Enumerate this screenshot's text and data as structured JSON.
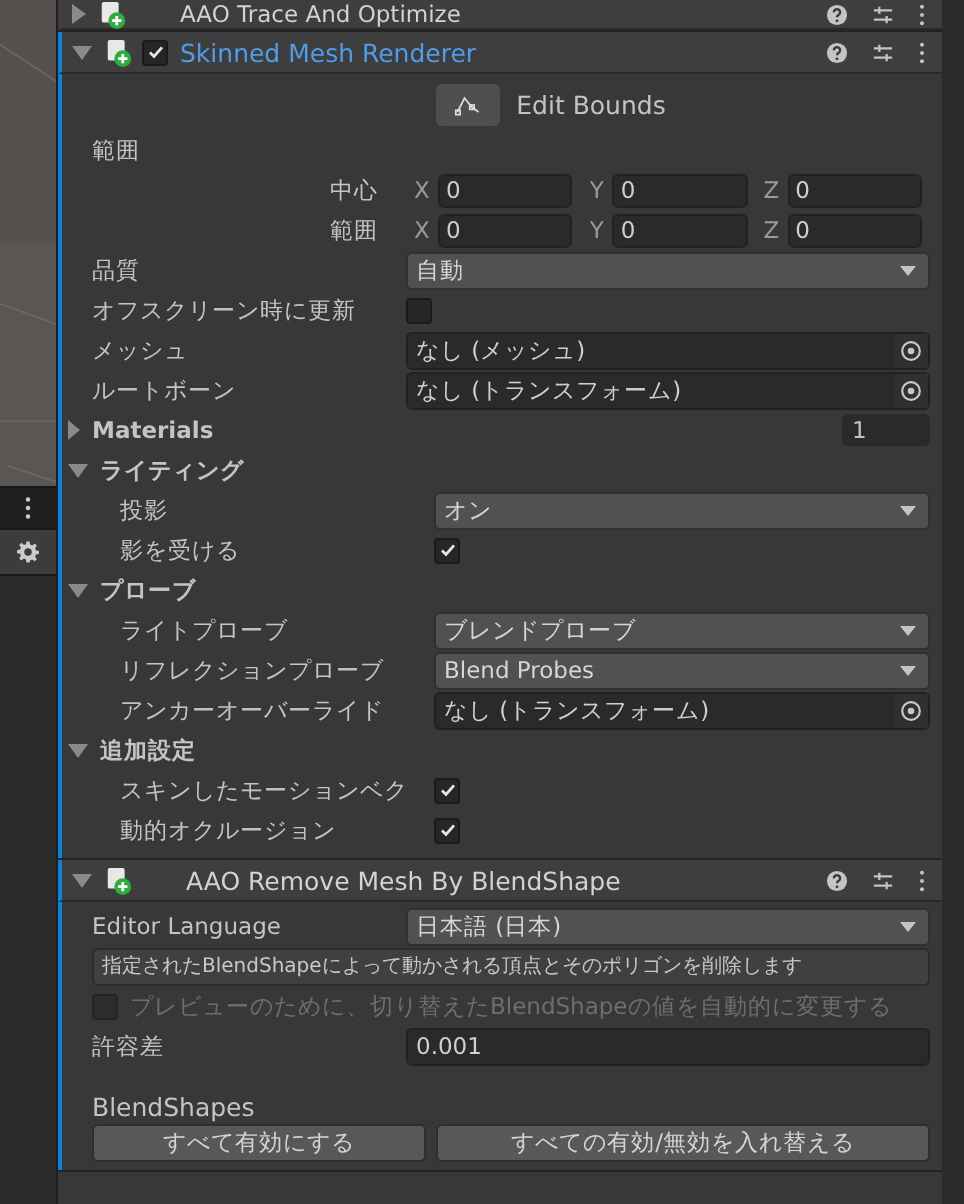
{
  "components": [
    {
      "title": "AAO Trace And Optimize",
      "expanded": false,
      "title_highlighted": false,
      "overridden": false
    },
    {
      "title": "Skinned Mesh Renderer",
      "expanded": true,
      "enabled": true,
      "title_highlighted": true,
      "overridden": true,
      "rows": [
        {
          "kind": "edit_bounds",
          "label": "Edit Bounds"
        },
        {
          "kind": "group",
          "label": "範囲",
          "children": [
            {
              "kind": "vector",
              "label": "中心",
              "fields": [
                {
                  "axis": "X",
                  "value": "0"
                },
                {
                  "axis": "Y",
                  "value": "0"
                },
                {
                  "axis": "Z",
                  "value": "0"
                }
              ]
            },
            {
              "kind": "vector",
              "label": "範囲",
              "fields": [
                {
                  "axis": "X",
                  "value": "0"
                },
                {
                  "axis": "Y",
                  "value": "0"
                },
                {
                  "axis": "Z",
                  "value": "0"
                }
              ]
            }
          ]
        },
        {
          "kind": "dropdown",
          "label": "品質",
          "value": "自動"
        },
        {
          "kind": "checkbox",
          "label": "オフスクリーン時に更新",
          "checked": false
        },
        {
          "kind": "object",
          "label": "メッシュ",
          "value": "なし (メッシュ)"
        },
        {
          "kind": "object",
          "label": "ルートボーン",
          "value": "なし (トランスフォーム)"
        },
        {
          "kind": "foldout",
          "label": "Materials",
          "expanded": false,
          "count": "1"
        },
        {
          "kind": "foldout",
          "label": "ライティング",
          "expanded": true,
          "children": [
            {
              "kind": "dropdown",
              "label": "投影",
              "value": "オン"
            },
            {
              "kind": "checkbox",
              "label": "影を受ける",
              "checked": true
            }
          ]
        },
        {
          "kind": "foldout",
          "label": "プローブ",
          "expanded": true,
          "children": [
            {
              "kind": "dropdown",
              "label": "ライトプローブ",
              "value": "ブレンドプローブ"
            },
            {
              "kind": "dropdown",
              "label": "リフレクションプローブ",
              "value": "Blend Probes"
            },
            {
              "kind": "object",
              "label": "アンカーオーバーライド",
              "value": "なし (トランスフォーム)"
            }
          ]
        },
        {
          "kind": "foldout",
          "label": "追加設定",
          "expanded": true,
          "children": [
            {
              "kind": "checkbox",
              "label": "スキンしたモーションベク",
              "checked": true
            },
            {
              "kind": "checkbox",
              "label": "動的オクルージョン",
              "checked": true
            }
          ]
        }
      ]
    },
    {
      "title": "AAO Remove Mesh By BlendShape",
      "expanded": true,
      "title_highlighted": false,
      "overridden": true,
      "rows": [
        {
          "kind": "dropdown",
          "label": "Editor Language",
          "value": "日本語 (日本)"
        },
        {
          "kind": "helpbox",
          "label": "指定されたBlendShapeによって動かされる頂点とそのポリゴンを削除します"
        },
        {
          "kind": "toggle_wide",
          "label": "プレビューのために、切り替えたBlendShapeの値を自動的に変更する",
          "checked": false,
          "disabled": true
        },
        {
          "kind": "number",
          "label": "許容差",
          "value": "0.001"
        },
        {
          "kind": "heading",
          "label": "BlendShapes"
        },
        {
          "kind": "buttons",
          "buttons": [
            "すべて有効にする",
            "すべての有効/無効を入れ替える"
          ]
        }
      ]
    }
  ]
}
